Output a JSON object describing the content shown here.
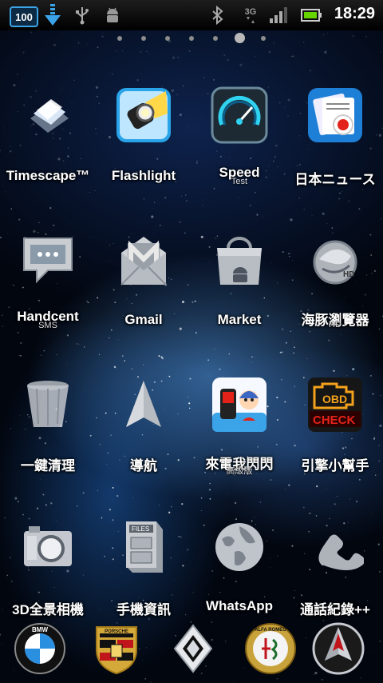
{
  "status_bar": {
    "battery_level": "100",
    "network": "3G",
    "time": "18:29",
    "icons": [
      "battery-level-icon",
      "download-icon",
      "usb-icon",
      "android-debug-icon",
      "bluetooth-icon",
      "network-3g-icon",
      "signal-icon",
      "battery-icon"
    ]
  },
  "pager": {
    "pages": 7,
    "active_page": 6
  },
  "apps": [
    {
      "label": "Timescape™",
      "sub": "",
      "icon": "timescape-icon"
    },
    {
      "label": "Flashlight",
      "sub": "",
      "icon": "flashlight-icon"
    },
    {
      "label": "Speed",
      "sub": "Test",
      "icon": "speedtest-icon"
    },
    {
      "label": "日本ニュース",
      "sub": "",
      "icon": "japan-news-icon"
    },
    {
      "label": "Handcent",
      "sub": "SMS",
      "icon": "handcent-sms-icon"
    },
    {
      "label": "Gmail",
      "sub": "",
      "icon": "gmail-icon"
    },
    {
      "label": "Market",
      "sub": "",
      "icon": "market-icon"
    },
    {
      "label": "海豚瀏覽器",
      "sub": "HD",
      "icon": "dolphin-browser-icon"
    },
    {
      "label": "一鍵清理",
      "sub": "",
      "icon": "trash-cleaner-icon"
    },
    {
      "label": "導航",
      "sub": "",
      "icon": "navigation-icon"
    },
    {
      "label": "來電我閃閃",
      "sub": "高級版",
      "icon": "call-flash-icon"
    },
    {
      "label": "引擎小幫手",
      "sub": "",
      "icon": "obd-check-icon"
    },
    {
      "label": "3D全景相機",
      "sub": "",
      "icon": "camera-icon"
    },
    {
      "label": "手機資訊",
      "sub": "",
      "icon": "phone-info-icon"
    },
    {
      "label": "WhatsApp",
      "sub": "",
      "icon": "whatsapp-icon"
    },
    {
      "label": "通話紀錄++",
      "sub": "",
      "icon": "call-log-icon"
    }
  ],
  "obd_icon_text": {
    "top": "OBD",
    "bottom": "CHECK"
  },
  "dock": [
    {
      "icon": "bmw-logo-icon",
      "text": "BMW"
    },
    {
      "icon": "porsche-logo-icon",
      "text": "PORSCHE"
    },
    {
      "icon": "renault-logo-icon",
      "text": ""
    },
    {
      "icon": "alfa-romeo-logo-icon",
      "text": "ALFA ROMEO"
    },
    {
      "icon": "pontiac-logo-icon",
      "text": ""
    }
  ],
  "colors": {
    "accent": "#3ba3e8",
    "battery_green": "#66d400",
    "obd_red": "#e3231a",
    "obd_orange": "#f4a21c"
  }
}
